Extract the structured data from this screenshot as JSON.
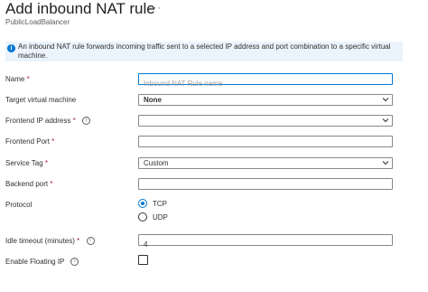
{
  "header": {
    "title": "Add inbound NAT rule",
    "more_label": "···",
    "subtitle": "PublicLoadBalancer"
  },
  "info": {
    "icon": "info-icon",
    "text": "An inbound NAT rule forwards incoming traffic sent to a selected IP address and port combination to a specific virtual machine."
  },
  "form": {
    "name": {
      "label": "Name",
      "required_mark": "*",
      "placeholder": "Inbound NAT Rule name",
      "value": ""
    },
    "target_vm": {
      "label": "Target virtual machine",
      "value": "None"
    },
    "frontend_ip": {
      "label": "Frontend IP address",
      "required_mark": "*",
      "value": ""
    },
    "frontend_port": {
      "label": "Frontend Port",
      "required_mark": "*",
      "value": ""
    },
    "service_tag": {
      "label": "Service Tag",
      "required_mark": "*",
      "value": "Custom"
    },
    "backend_port": {
      "label": "Backend port",
      "required_mark": "*",
      "value": ""
    },
    "protocol": {
      "label": "Protocol",
      "options": [
        "TCP",
        "UDP"
      ],
      "selected": "TCP"
    },
    "idle_timeout": {
      "label": "Idle timeout (minutes)",
      "required_mark": "*",
      "value": "4"
    },
    "floating_ip": {
      "label": "Enable Floating IP",
      "checked": false
    }
  },
  "colors": {
    "accent": "#0078d4",
    "required": "#a4262c",
    "info_background": "#ebf3fc"
  }
}
